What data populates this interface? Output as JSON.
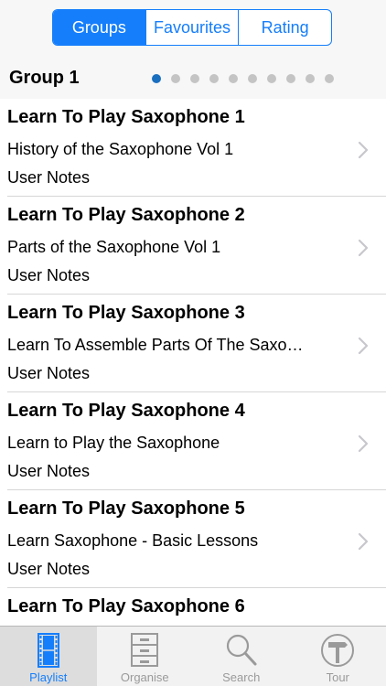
{
  "segments": [
    {
      "label": "Groups",
      "active": true
    },
    {
      "label": "Favourites",
      "active": false
    },
    {
      "label": "Rating",
      "active": false
    }
  ],
  "group": {
    "title": "Group 1",
    "page_count": 10,
    "current_page": 1
  },
  "rows": [
    {
      "title": "Learn To Play Saxophone 1",
      "subtitle": "History of the Saxophone Vol 1",
      "notes": "User Notes"
    },
    {
      "title": "Learn To Play Saxophone 2",
      "subtitle": "Parts of the Saxophone Vol 1",
      "notes": "User Notes"
    },
    {
      "title": "Learn To Play Saxophone 3",
      "subtitle": "Learn To Assemble Parts Of The Saxo…",
      "notes": "User Notes"
    },
    {
      "title": "Learn To Play Saxophone 4",
      "subtitle": "Learn to Play the Saxophone",
      "notes": "User Notes"
    },
    {
      "title": "Learn To Play Saxophone 5",
      "subtitle": "Learn Saxophone - Basic Lessons",
      "notes": "User Notes"
    },
    {
      "title": "Learn To Play Saxophone 6",
      "subtitle": "",
      "notes": ""
    }
  ],
  "tabs": [
    {
      "label": "Playlist",
      "icon": "film-icon",
      "active": true
    },
    {
      "label": "Organise",
      "icon": "cabinet-icon",
      "active": false
    },
    {
      "label": "Search",
      "icon": "magnifier-icon",
      "active": false
    },
    {
      "label": "Tour",
      "icon": "signpost-icon",
      "active": false
    }
  ],
  "colors": {
    "accent": "#157efb",
    "dot_active": "#1a6fbf",
    "dot_inactive": "#c4c4c4",
    "tab_inactive": "#9a9a9a"
  }
}
